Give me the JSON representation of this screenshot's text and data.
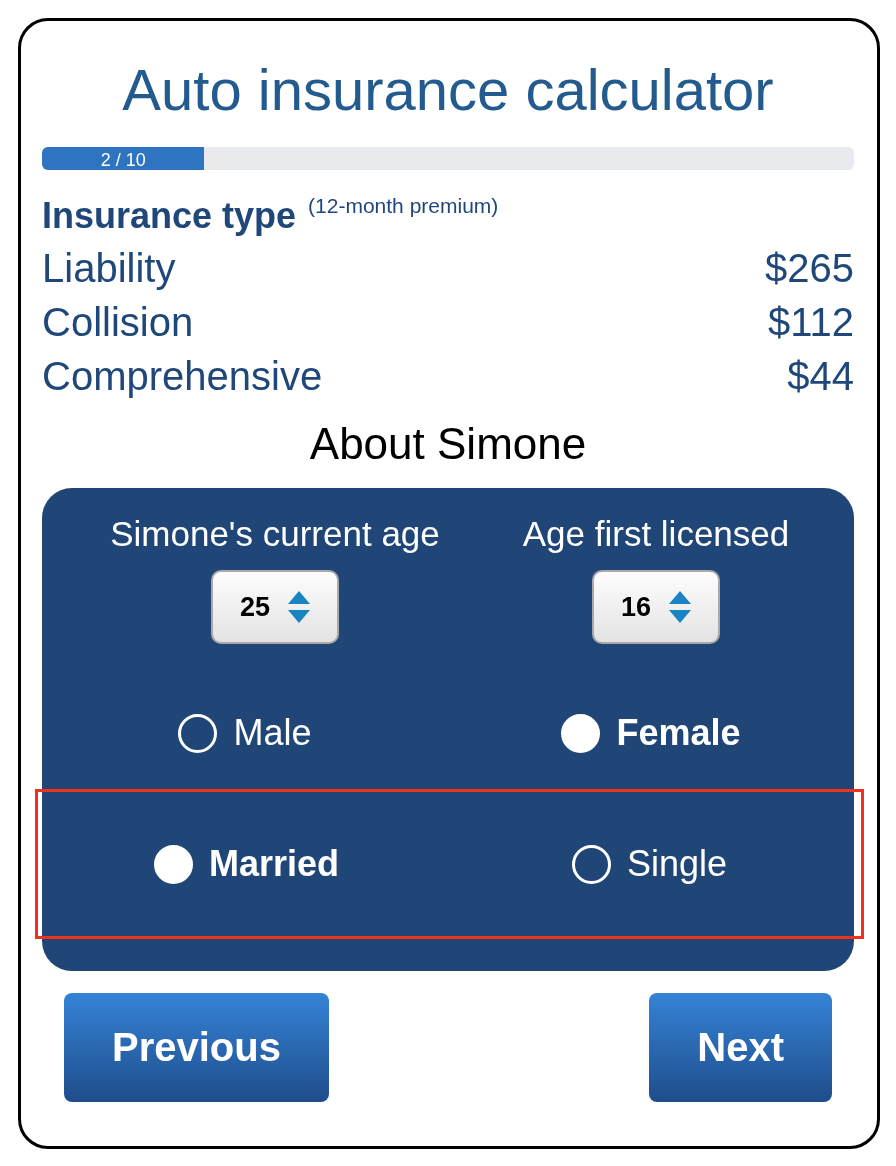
{
  "title": "Auto insurance calculator",
  "progress": {
    "label": "2 / 10",
    "level": 0.2
  },
  "premiums": {
    "heading": "Insurance type",
    "note": "(12-month premium)",
    "rows": [
      {
        "name": "Liability",
        "amount": "$265"
      },
      {
        "name": "Collision",
        "amount": "$112"
      },
      {
        "name": "Comprehensive",
        "amount": "$44"
      }
    ]
  },
  "driver": {
    "heading": "About Simone",
    "fields": [
      {
        "label": "Simone's current age",
        "value": "25"
      },
      {
        "label": "Age first licensed",
        "value": "16"
      }
    ],
    "choices": [
      {
        "highlighted": false,
        "options": [
          {
            "label": "Male",
            "selected": false
          },
          {
            "label": "Female",
            "selected": true
          }
        ]
      },
      {
        "highlighted": true,
        "options": [
          {
            "label": "Married",
            "selected": true
          },
          {
            "label": "Single",
            "selected": false
          }
        ]
      }
    ]
  },
  "buttons": [
    "Previous",
    "Next"
  ]
}
